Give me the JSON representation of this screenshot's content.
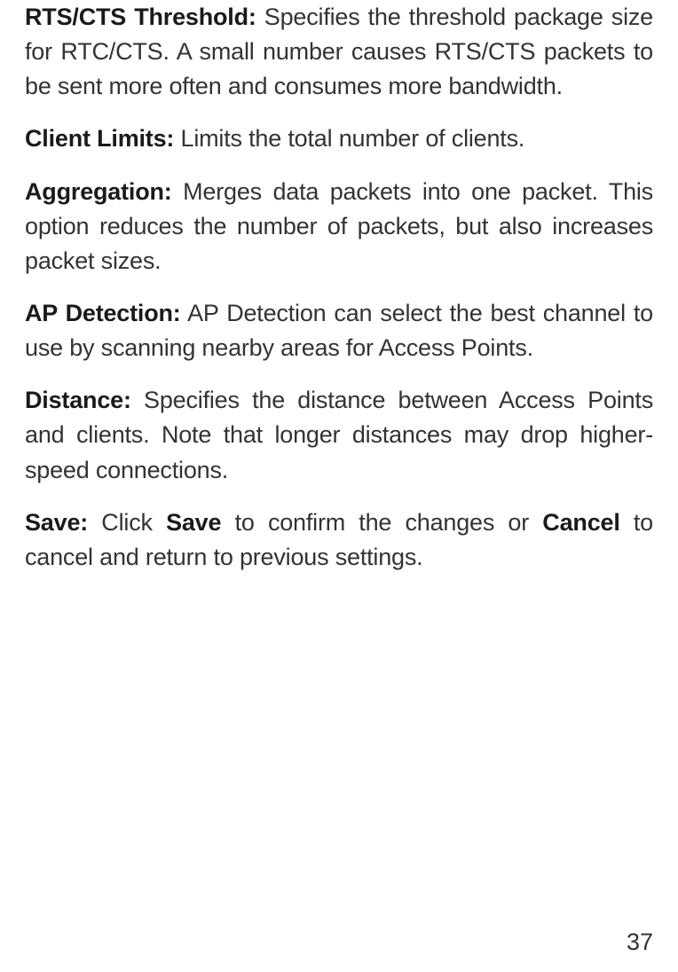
{
  "entries": [
    {
      "term": "RTS/CTS Threshold:",
      "desc": " Specifies the threshold package size for RTC/CTS. A small number causes RTS/CTS packets to be sent more often and consumes more bandwidth."
    },
    {
      "term": "Client Limits:",
      "desc": " Limits the total number of clients."
    },
    {
      "term": "Aggregation:",
      "desc": " Merges data packets into one packet. This option reduces the number of packets, but also increases packet sizes."
    },
    {
      "term": "AP Detection:",
      "desc": " AP Detection can select the best channel to use by scanning nearby areas for Access Points."
    },
    {
      "term": "Distance:",
      "desc": " Specifies the distance between Access Points and clients. Note that longer distances may drop higher-speed connections."
    }
  ],
  "save_entry": {
    "term": "Save:",
    "pre": " Click ",
    "bold1": "Save",
    "mid": " to confirm the changes or ",
    "bold2": "Cancel",
    "post": " to cancel and return to previous settings."
  },
  "page_number": "37"
}
